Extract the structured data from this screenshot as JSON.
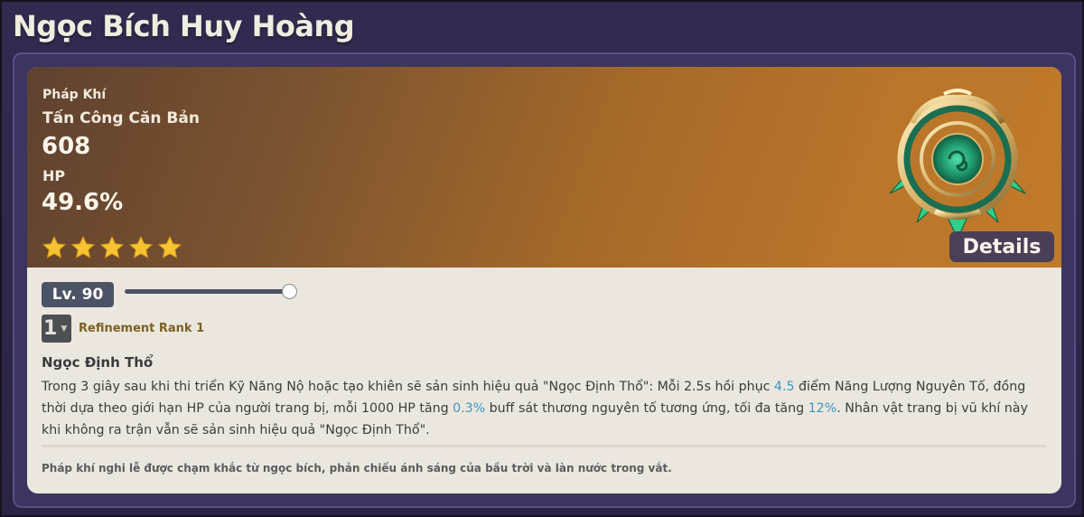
{
  "page": {
    "title": "Ngọc Bích Huy Hoàng"
  },
  "weapon": {
    "type": "Pháp Khí",
    "stat1_label": "Tấn Công Căn Bản",
    "stat1_value": "608",
    "stat2_label": "HP",
    "stat2_value": "49.6%",
    "rarity_stars": 5,
    "star_color": "#f7c332",
    "details_label": "Details",
    "weapon_art_icon": "jade-catalyst-icon"
  },
  "level": {
    "label": "Lv. 90",
    "slider_fraction": 1.0
  },
  "refinement": {
    "selected": "1",
    "label": "Refinement Rank 1"
  },
  "passive": {
    "name": "Ngọc Định Thổ",
    "desc_parts": [
      "Trong 3 giây sau khi thi triển Kỹ Năng Nộ hoặc tạo khiên sẽ sản sinh hiệu quả \"Ngọc Định Thổ\": Mỗi 2.5s hồi phục ",
      "4.5",
      " điểm Năng Lượng Nguyên Tố, đồng thời dựa theo giới hạn HP của người trang bị, mỗi 1000 HP tăng ",
      "0.3%",
      " buff sát thương nguyên tố tương ứng, tối đa tăng ",
      "12%",
      ". Nhân vật trang bị vũ khí này khi không ra trận vẫn sẽ sản sinh hiệu quả \"Ngọc Định Thổ\"."
    ],
    "highlight_color": "#3b96c8"
  },
  "lore": "Pháp khí nghi lễ được chạm khắc từ ngọc bích, phản chiếu ánh sáng của bầu trời và làn nước trong vắt."
}
